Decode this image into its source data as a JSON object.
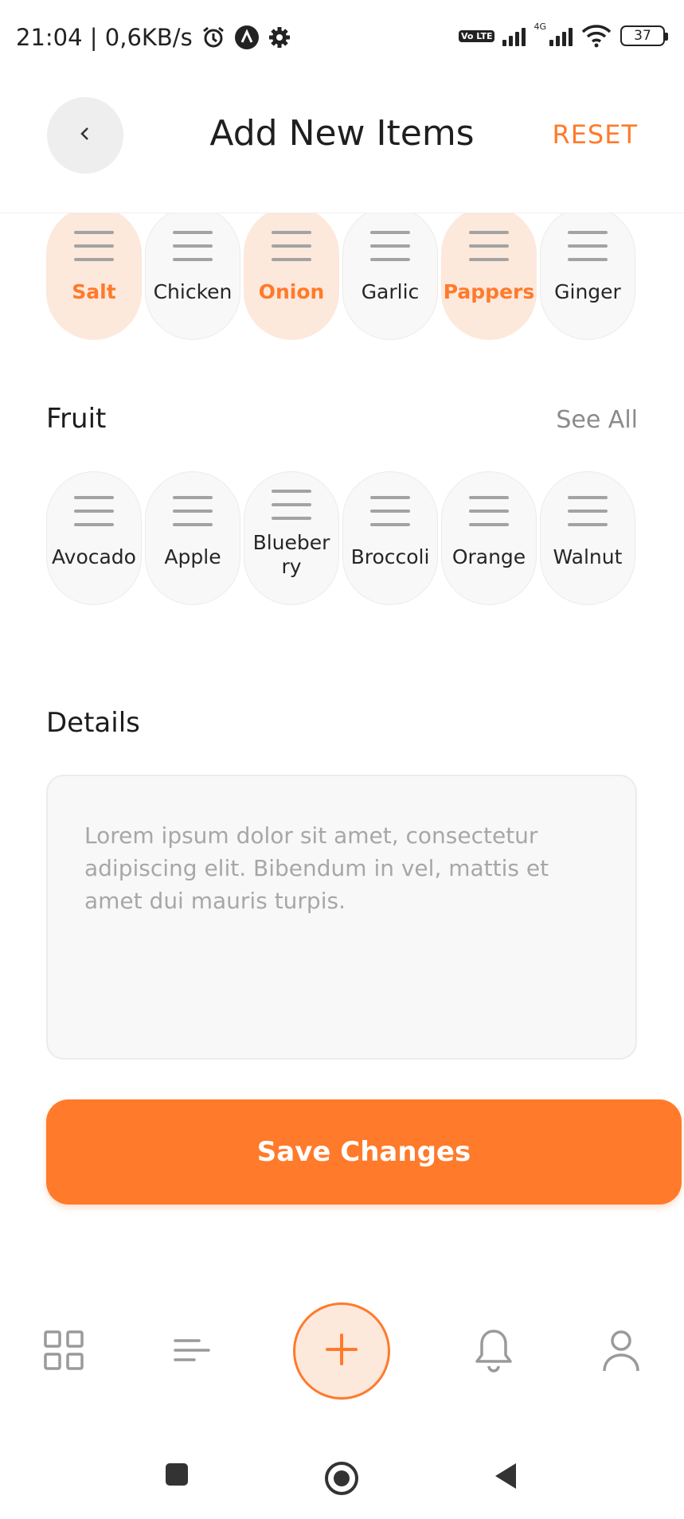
{
  "status_bar": {
    "time_speed": "21:04 | 0,6KB/s",
    "network_type": "4G",
    "volte": "Vo LTE",
    "battery": "37"
  },
  "header": {
    "back_icon": "chevron-left-icon",
    "title": "Add New Items",
    "reset_label": "RESET"
  },
  "spices": {
    "items": [
      {
        "label": "Salt",
        "selected": true
      },
      {
        "label": "Chicken",
        "selected": false
      },
      {
        "label": "Onion",
        "selected": true
      },
      {
        "label": "Garlic",
        "selected": false
      },
      {
        "label": "Pappers",
        "selected": true
      },
      {
        "label": "Ginger",
        "selected": false
      }
    ]
  },
  "fruit": {
    "title": "Fruit",
    "see_all_label": "See All",
    "items": [
      {
        "label": "Avocado",
        "selected": false
      },
      {
        "label": "Apple",
        "selected": false
      },
      {
        "label": "Blueberry",
        "selected": false
      },
      {
        "label": "Broccoli",
        "selected": false
      },
      {
        "label": "Orange",
        "selected": false
      },
      {
        "label": "Walnut",
        "selected": false
      }
    ]
  },
  "details": {
    "title": "Details",
    "placeholder": "Lorem ipsum dolor sit amet, consectetur adipiscing elit. Bibendum in vel, mattis et amet dui mauris turpis."
  },
  "save_button_label": "Save Changes",
  "bottom_nav": {
    "items": [
      "grid-icon",
      "list-icon",
      "plus-icon",
      "bell-icon",
      "user-icon"
    ]
  },
  "colors": {
    "accent": "#ff7a2a",
    "accent_soft": "#fde8dc",
    "chip_bg": "#f8f8f8"
  }
}
